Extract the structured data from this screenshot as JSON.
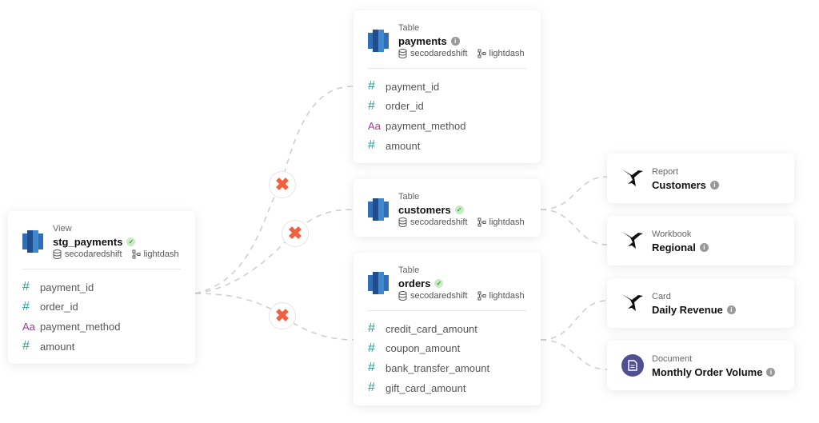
{
  "nodes": {
    "stg_payments": {
      "type": "View",
      "name": "stg_payments",
      "verified": true,
      "database": "secodaredshift",
      "project": "lightdash",
      "columns": [
        {
          "kind": "number",
          "name": "payment_id"
        },
        {
          "kind": "number",
          "name": "order_id"
        },
        {
          "kind": "string",
          "name": "payment_method"
        },
        {
          "kind": "number",
          "name": "amount"
        }
      ]
    },
    "payments": {
      "type": "Table",
      "name": "payments",
      "verified": false,
      "database": "secodaredshift",
      "project": "lightdash",
      "columns": [
        {
          "kind": "number",
          "name": "payment_id"
        },
        {
          "kind": "number",
          "name": "order_id"
        },
        {
          "kind": "string",
          "name": "payment_method"
        },
        {
          "kind": "number",
          "name": "amount"
        }
      ]
    },
    "customers": {
      "type": "Table",
      "name": "customers",
      "verified": true,
      "database": "secodaredshift",
      "project": "lightdash",
      "columns": []
    },
    "orders": {
      "type": "Table",
      "name": "orders",
      "verified": true,
      "database": "secodaredshift",
      "project": "lightdash",
      "columns": [
        {
          "kind": "number",
          "name": "credit_card_amount"
        },
        {
          "kind": "number",
          "name": "coupon_amount"
        },
        {
          "kind": "number",
          "name": "bank_transfer_amount"
        },
        {
          "kind": "number",
          "name": "gift_card_amount"
        }
      ]
    }
  },
  "outputs": [
    {
      "type": "Report",
      "name": "Customers",
      "icon": "tableau-bird-icon"
    },
    {
      "type": "Workbook",
      "name": "Regional",
      "icon": "tableau-bird-icon"
    },
    {
      "type": "Card",
      "name": "Daily Revenue",
      "icon": "tableau-bird-icon"
    },
    {
      "type": "Document",
      "name": "Monthly Order Volume",
      "icon": "document-icon"
    }
  ],
  "glyphs": {
    "number": "#",
    "string": "Aa",
    "dbt": "✖"
  },
  "colors": {
    "number": "#2aa198",
    "string": "#a03a9a",
    "dbt": "#f2613f",
    "redshift": "#2f6fb8",
    "document": "#4f4f91"
  }
}
